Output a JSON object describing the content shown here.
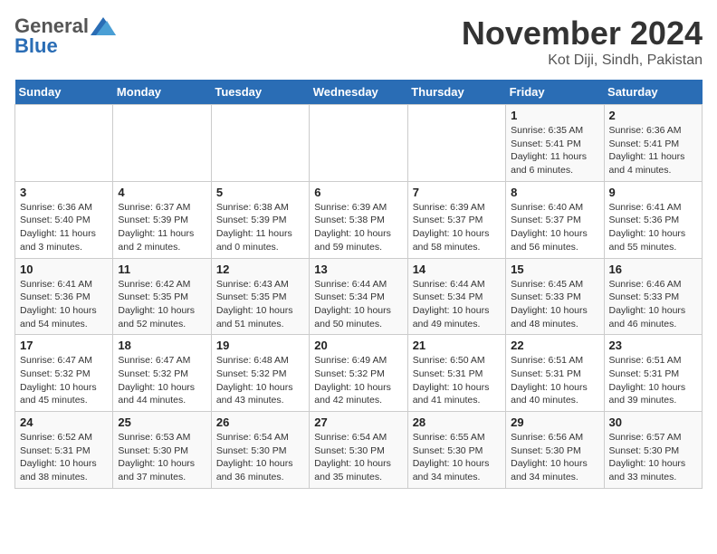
{
  "header": {
    "logo_general": "General",
    "logo_blue": "Blue",
    "month": "November 2024",
    "location": "Kot Diji, Sindh, Pakistan"
  },
  "weekdays": [
    "Sunday",
    "Monday",
    "Tuesday",
    "Wednesday",
    "Thursday",
    "Friday",
    "Saturday"
  ],
  "weeks": [
    [
      {
        "day": null,
        "info": null
      },
      {
        "day": null,
        "info": null
      },
      {
        "day": null,
        "info": null
      },
      {
        "day": null,
        "info": null
      },
      {
        "day": null,
        "info": null
      },
      {
        "day": "1",
        "info": "Sunrise: 6:35 AM\nSunset: 5:41 PM\nDaylight: 11 hours and 6 minutes."
      },
      {
        "day": "2",
        "info": "Sunrise: 6:36 AM\nSunset: 5:41 PM\nDaylight: 11 hours and 4 minutes."
      }
    ],
    [
      {
        "day": "3",
        "info": "Sunrise: 6:36 AM\nSunset: 5:40 PM\nDaylight: 11 hours and 3 minutes."
      },
      {
        "day": "4",
        "info": "Sunrise: 6:37 AM\nSunset: 5:39 PM\nDaylight: 11 hours and 2 minutes."
      },
      {
        "day": "5",
        "info": "Sunrise: 6:38 AM\nSunset: 5:39 PM\nDaylight: 11 hours and 0 minutes."
      },
      {
        "day": "6",
        "info": "Sunrise: 6:39 AM\nSunset: 5:38 PM\nDaylight: 10 hours and 59 minutes."
      },
      {
        "day": "7",
        "info": "Sunrise: 6:39 AM\nSunset: 5:37 PM\nDaylight: 10 hours and 58 minutes."
      },
      {
        "day": "8",
        "info": "Sunrise: 6:40 AM\nSunset: 5:37 PM\nDaylight: 10 hours and 56 minutes."
      },
      {
        "day": "9",
        "info": "Sunrise: 6:41 AM\nSunset: 5:36 PM\nDaylight: 10 hours and 55 minutes."
      }
    ],
    [
      {
        "day": "10",
        "info": "Sunrise: 6:41 AM\nSunset: 5:36 PM\nDaylight: 10 hours and 54 minutes."
      },
      {
        "day": "11",
        "info": "Sunrise: 6:42 AM\nSunset: 5:35 PM\nDaylight: 10 hours and 52 minutes."
      },
      {
        "day": "12",
        "info": "Sunrise: 6:43 AM\nSunset: 5:35 PM\nDaylight: 10 hours and 51 minutes."
      },
      {
        "day": "13",
        "info": "Sunrise: 6:44 AM\nSunset: 5:34 PM\nDaylight: 10 hours and 50 minutes."
      },
      {
        "day": "14",
        "info": "Sunrise: 6:44 AM\nSunset: 5:34 PM\nDaylight: 10 hours and 49 minutes."
      },
      {
        "day": "15",
        "info": "Sunrise: 6:45 AM\nSunset: 5:33 PM\nDaylight: 10 hours and 48 minutes."
      },
      {
        "day": "16",
        "info": "Sunrise: 6:46 AM\nSunset: 5:33 PM\nDaylight: 10 hours and 46 minutes."
      }
    ],
    [
      {
        "day": "17",
        "info": "Sunrise: 6:47 AM\nSunset: 5:32 PM\nDaylight: 10 hours and 45 minutes."
      },
      {
        "day": "18",
        "info": "Sunrise: 6:47 AM\nSunset: 5:32 PM\nDaylight: 10 hours and 44 minutes."
      },
      {
        "day": "19",
        "info": "Sunrise: 6:48 AM\nSunset: 5:32 PM\nDaylight: 10 hours and 43 minutes."
      },
      {
        "day": "20",
        "info": "Sunrise: 6:49 AM\nSunset: 5:32 PM\nDaylight: 10 hours and 42 minutes."
      },
      {
        "day": "21",
        "info": "Sunrise: 6:50 AM\nSunset: 5:31 PM\nDaylight: 10 hours and 41 minutes."
      },
      {
        "day": "22",
        "info": "Sunrise: 6:51 AM\nSunset: 5:31 PM\nDaylight: 10 hours and 40 minutes."
      },
      {
        "day": "23",
        "info": "Sunrise: 6:51 AM\nSunset: 5:31 PM\nDaylight: 10 hours and 39 minutes."
      }
    ],
    [
      {
        "day": "24",
        "info": "Sunrise: 6:52 AM\nSunset: 5:31 PM\nDaylight: 10 hours and 38 minutes."
      },
      {
        "day": "25",
        "info": "Sunrise: 6:53 AM\nSunset: 5:30 PM\nDaylight: 10 hours and 37 minutes."
      },
      {
        "day": "26",
        "info": "Sunrise: 6:54 AM\nSunset: 5:30 PM\nDaylight: 10 hours and 36 minutes."
      },
      {
        "day": "27",
        "info": "Sunrise: 6:54 AM\nSunset: 5:30 PM\nDaylight: 10 hours and 35 minutes."
      },
      {
        "day": "28",
        "info": "Sunrise: 6:55 AM\nSunset: 5:30 PM\nDaylight: 10 hours and 34 minutes."
      },
      {
        "day": "29",
        "info": "Sunrise: 6:56 AM\nSunset: 5:30 PM\nDaylight: 10 hours and 34 minutes."
      },
      {
        "day": "30",
        "info": "Sunrise: 6:57 AM\nSunset: 5:30 PM\nDaylight: 10 hours and 33 minutes."
      }
    ]
  ]
}
